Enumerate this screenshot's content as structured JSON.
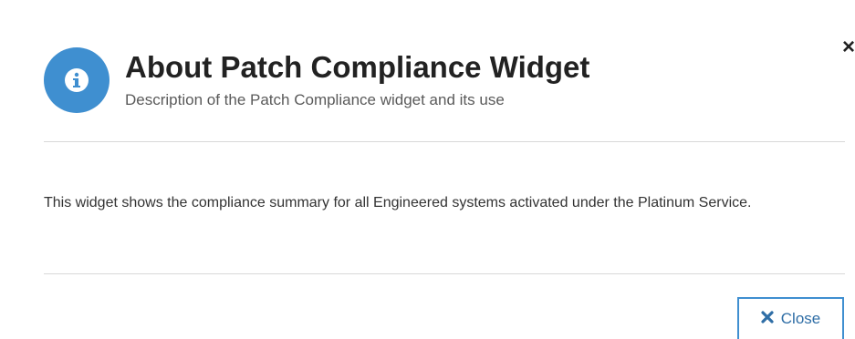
{
  "dialog": {
    "close_glyph": "×",
    "title": "About Patch Compliance Widget",
    "subtitle": "Description of the Patch Compliance widget and its use",
    "body": "This widget shows the compliance summary for all Engineered systems activated under the Platinum Service.",
    "close_label": "Close",
    "icon": "info-icon",
    "close_icon": "x-icon",
    "accent_color": "#3f8fd0"
  }
}
